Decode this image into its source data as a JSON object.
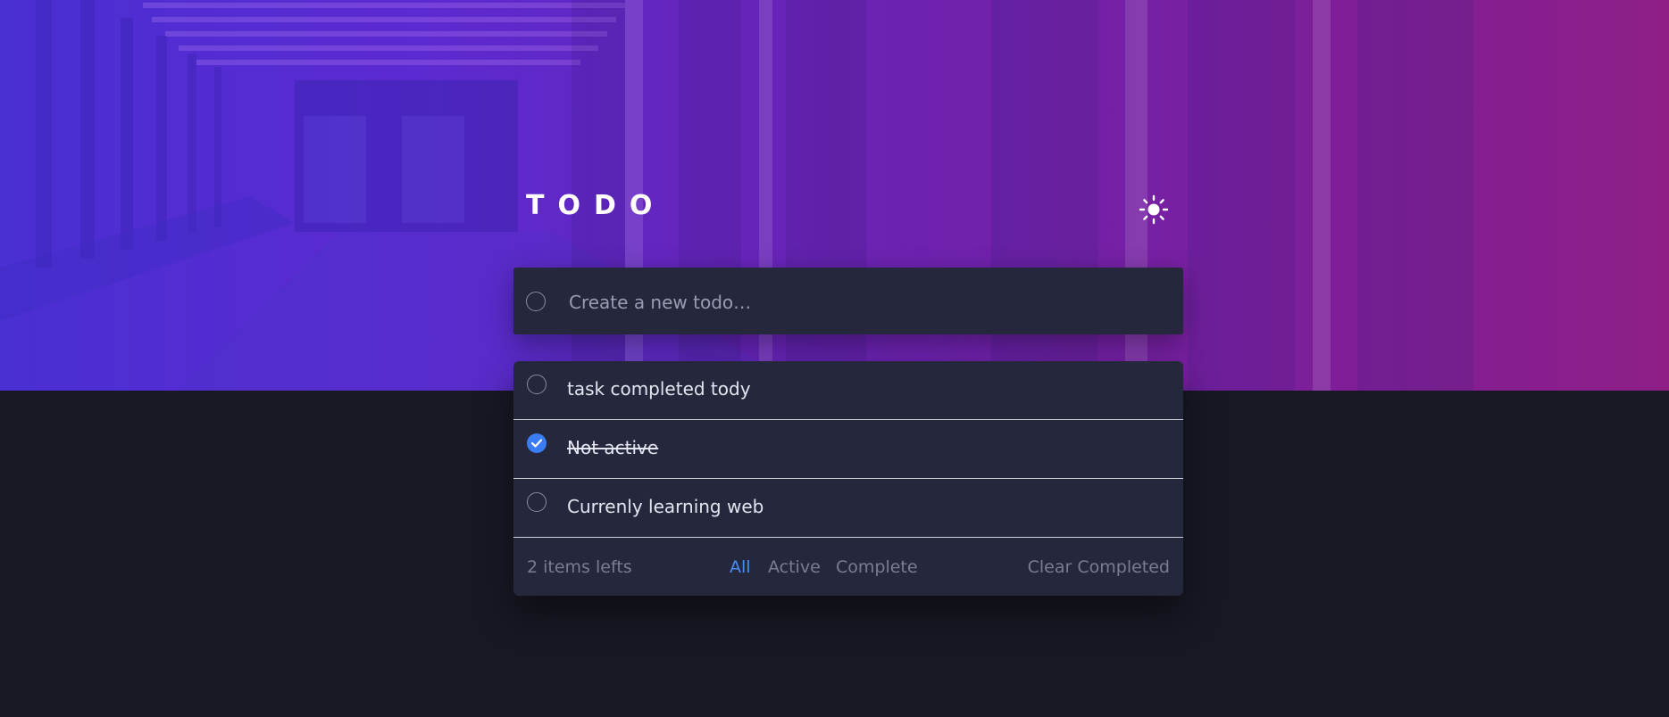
{
  "app": {
    "title": "TODO",
    "theme_toggle_icon": "sun-icon"
  },
  "colors": {
    "background": "#181824",
    "card": "#25273c",
    "accent": "#3a7cf3",
    "muted_text": "#7b7c92",
    "item_text": "#e4e5f1"
  },
  "new_todo": {
    "placeholder": "Create a new todo…",
    "value": ""
  },
  "todos": [
    {
      "label": "task completed tody",
      "completed": false
    },
    {
      "label": "Not active",
      "completed": true
    },
    {
      "label": "Currenly learning web",
      "completed": false
    }
  ],
  "footer": {
    "items_left": "2 items lefts",
    "filters": {
      "all": "All",
      "active": "Active",
      "complete": "Complete"
    },
    "selected_filter": "All",
    "clear_completed": "Clear Completed"
  }
}
